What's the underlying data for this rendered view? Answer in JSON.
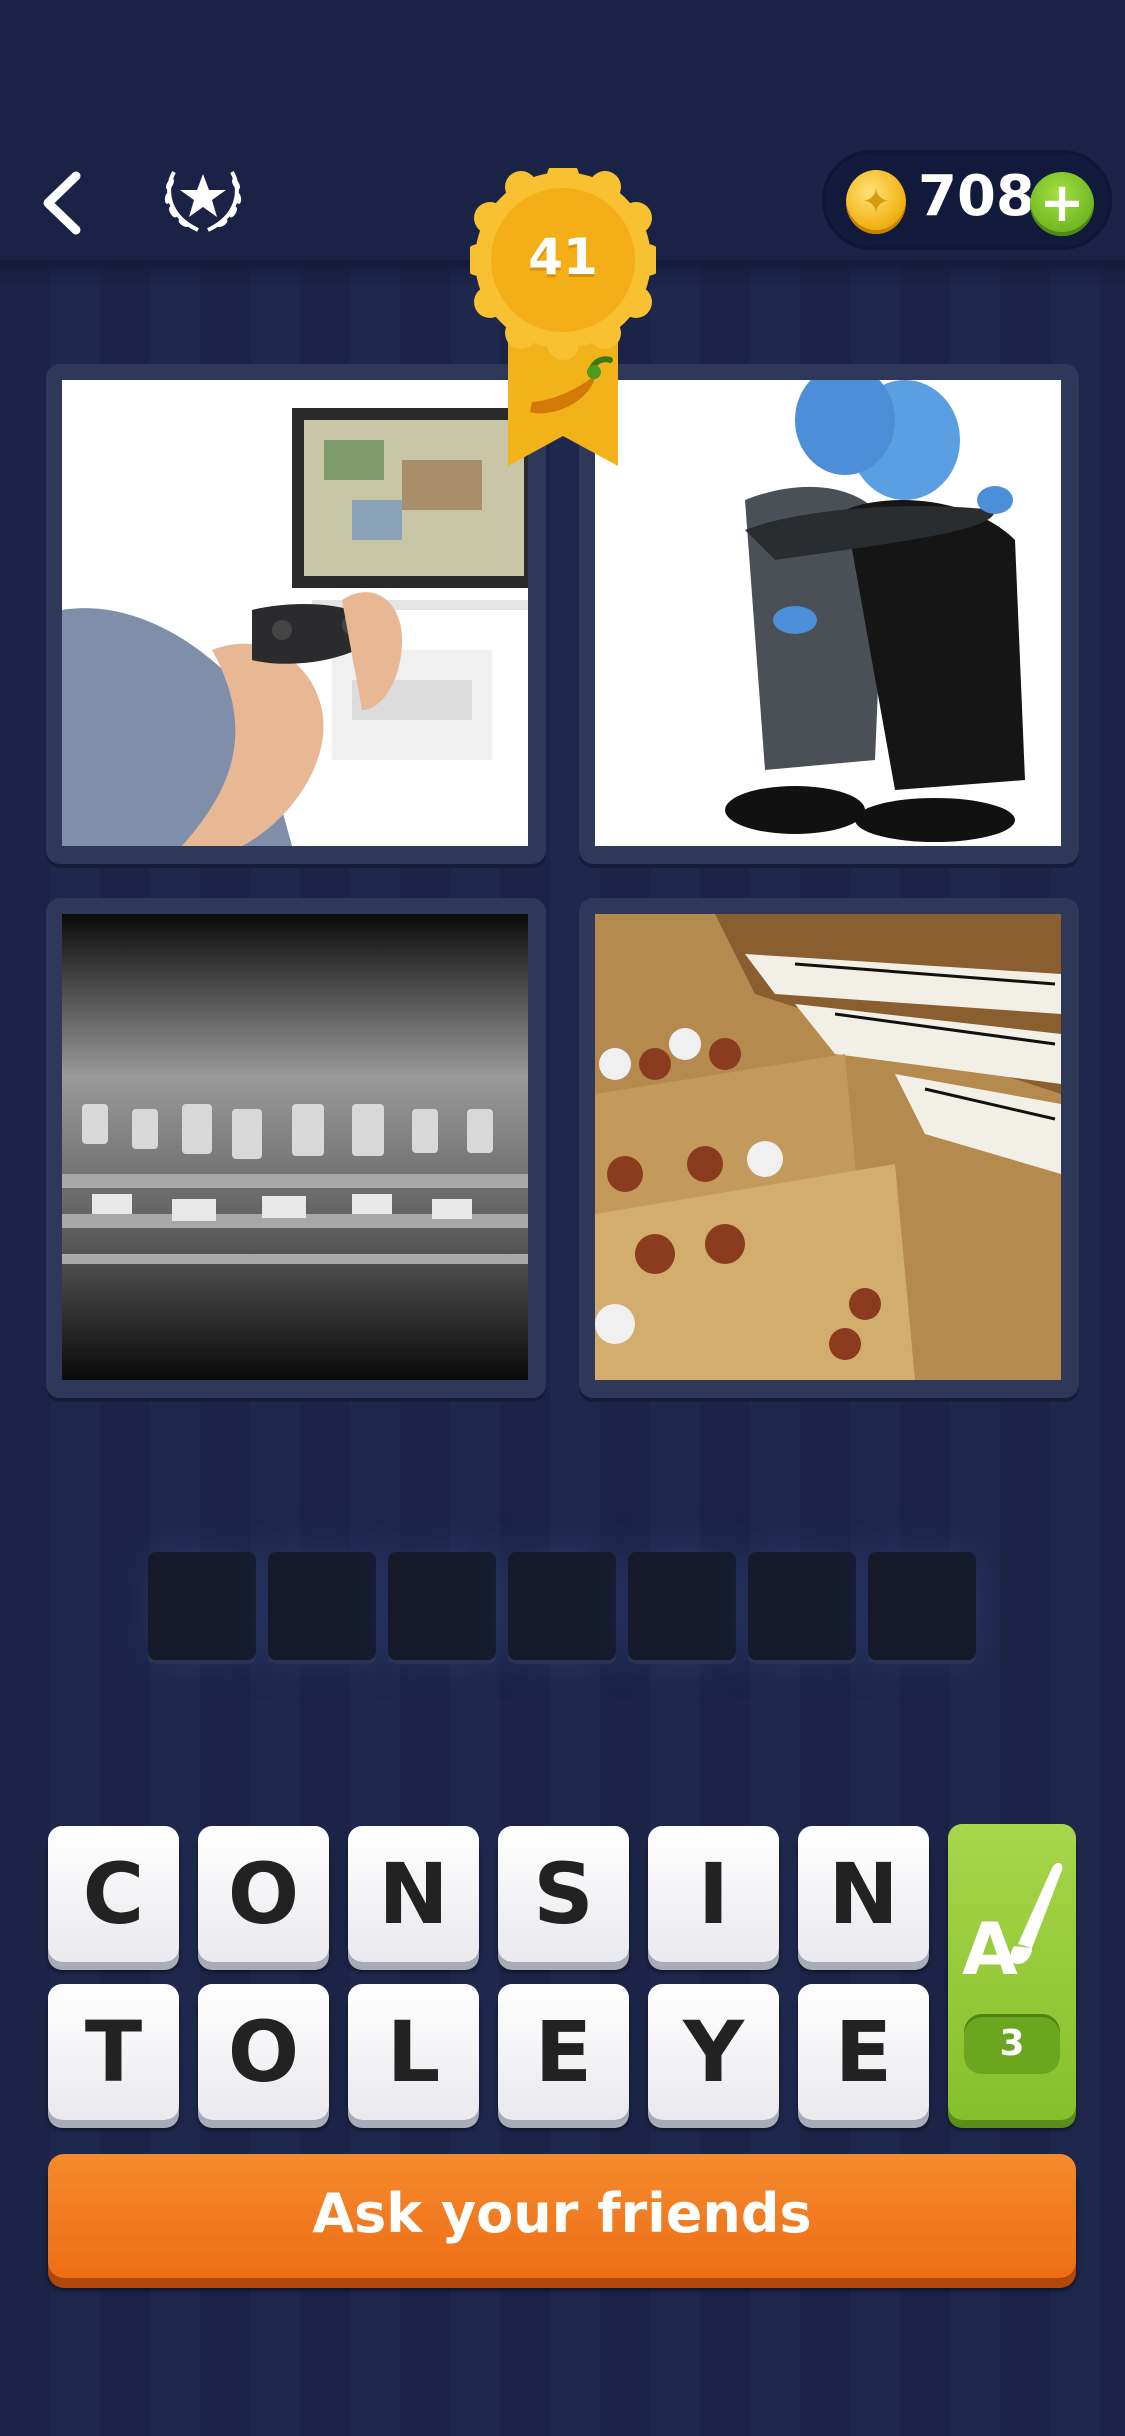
{
  "header": {
    "back_icon": "chevron-left-icon",
    "achievements_icon": "laurel-star-icon",
    "coins": "708",
    "coin_icon": "coin-icon",
    "add_coins_icon": "plus-icon"
  },
  "level": {
    "number": "41",
    "difficulty_icon": "chili-pepper-icon"
  },
  "puzzle": {
    "images": [
      {
        "subject": "person holding a game controller in front of a TV"
      },
      {
        "subject": "two figures in suits hugging"
      },
      {
        "subject": "audio mixing console knobs"
      },
      {
        "subject": "pipe organ keyboards and stops"
      }
    ],
    "answer_slots": 7
  },
  "letters": {
    "row1": [
      "C",
      "O",
      "N",
      "S",
      "I",
      "N"
    ],
    "row2": [
      "T",
      "O",
      "L",
      "E",
      "Y",
      "E"
    ]
  },
  "hint": {
    "icon": "letter-brush-icon",
    "count": "3"
  },
  "ask_friends": {
    "label": "Ask your friends"
  },
  "colors": {
    "background": "#1b2446",
    "accent_orange": "#f07a1f",
    "accent_green": "#86bf2c",
    "badge_gold": "#f3b519"
  }
}
